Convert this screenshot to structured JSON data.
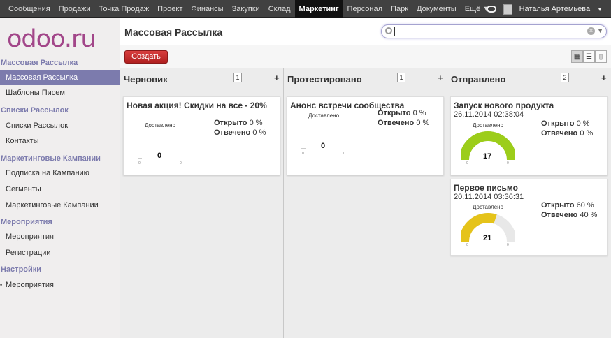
{
  "topnav": {
    "items": [
      "Сообщения",
      "Продажи",
      "Точка Продаж",
      "Проект",
      "Финансы",
      "Закупки",
      "Склад",
      "Маркетинг",
      "Персонал",
      "Парк",
      "Документы",
      "Ещё"
    ],
    "active": "Маркетинг",
    "user": "Наталья Артемьева"
  },
  "logo": "odoo.ru",
  "sidebar": {
    "sections": [
      {
        "title": "Массовая Рассылка",
        "items": [
          "Массовая Рассылка",
          "Шаблоны Писем"
        ]
      },
      {
        "title": "Списки Рассылок",
        "items": [
          "Списки Рассылок",
          "Контакты"
        ]
      },
      {
        "title": "Маркетинговые Кампании",
        "items": [
          "Подписка на Кампанию",
          "Сегменты",
          "Маркетинговые Кампании"
        ]
      },
      {
        "title": "Мероприятия",
        "items": [
          "Мероприятия",
          "Регистрации"
        ]
      },
      {
        "title": "Настройки",
        "items": [
          "Мероприятия"
        ]
      }
    ],
    "active_item": "Массовая Рассылка"
  },
  "page": {
    "title": "Массовая Рассылка",
    "create": "Создать",
    "search_value": ""
  },
  "columns": [
    {
      "title": "Черновик",
      "count": "1",
      "cards": [
        {
          "title": "Новая акция! Скидки на все - 20%",
          "date": "",
          "delivered_label": "Доставлено",
          "opened_label": "Открыто",
          "opened": "0 %",
          "replied_label": "Отвечено",
          "replied": "0 %",
          "value": "0",
          "tick_min": "0",
          "tick_max": "0",
          "fraction": 0
        }
      ]
    },
    {
      "title": "Протестировано",
      "count": "1",
      "cards": [
        {
          "title": "Анонс встречи сообщества",
          "date": "",
          "delivered_label": "Доставлено",
          "opened_label": "Открыто",
          "opened": "0 %",
          "replied_label": "Отвечено",
          "replied": "0 %",
          "value": "0",
          "tick_min": "0",
          "tick_max": "0",
          "fraction": 0
        }
      ]
    },
    {
      "title": "Отправлено",
      "count": "2",
      "cards": [
        {
          "title": "Запуск нового продукта",
          "date": "26.11.2014 02:38:04",
          "delivered_label": "Доставлено",
          "opened_label": "Открыто",
          "opened": "0 %",
          "replied_label": "Отвечено",
          "replied": "0 %",
          "value": "17",
          "tick_min": "0",
          "tick_max": "0",
          "fraction": 1,
          "color": "#9ccd1a"
        },
        {
          "title": "Первое письмо",
          "date": "20.11.2014 03:36:31",
          "delivered_label": "Доставлено",
          "opened_label": "Открыто",
          "opened": "60 %",
          "replied_label": "Отвечено",
          "replied": "40 %",
          "value": "21",
          "tick_min": "0",
          "tick_max": "0",
          "fraction": 0.6,
          "color": "#e5c31a"
        }
      ]
    }
  ],
  "colors": {
    "accent": "#7c7bad",
    "create": "#c12b2b",
    "topbar": "#414141",
    "logo": "#a24689"
  }
}
